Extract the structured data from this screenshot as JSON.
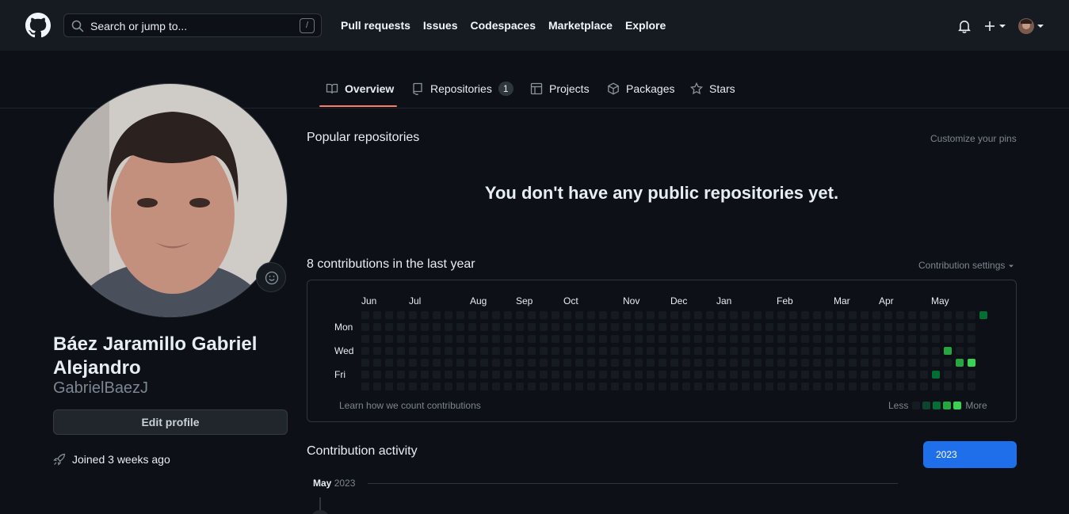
{
  "header": {
    "search_placeholder": "Search or jump to...",
    "search_shortcut": "/",
    "nav": [
      "Pull requests",
      "Issues",
      "Codespaces",
      "Marketplace",
      "Explore"
    ]
  },
  "tabs": {
    "overview": "Overview",
    "repositories": "Repositories",
    "repositories_count": "1",
    "projects": "Projects",
    "packages": "Packages",
    "stars": "Stars"
  },
  "profile": {
    "full_name": "Báez Jaramillo Gabriel Alejandro",
    "login": "GabrielBaezJ",
    "edit_label": "Edit profile",
    "joined": "Joined 3 weeks ago"
  },
  "popular": {
    "title": "Popular repositories",
    "customize": "Customize your pins",
    "empty": "You don't have any public repositories yet."
  },
  "contributions": {
    "title": "8 contributions in the last year",
    "settings": "Contribution settings",
    "months": [
      "Jun",
      "Jul",
      "Aug",
      "Sep",
      "Oct",
      "Nov",
      "Dec",
      "Jan",
      "Feb",
      "Mar",
      "Apr",
      "May"
    ],
    "day_labels": [
      "Mon",
      "Wed",
      "Fri"
    ],
    "learn": "Learn how we count contributions",
    "less": "Less",
    "more": "More",
    "weeks": 53,
    "active_cells": [
      {
        "week": 48,
        "day": 5,
        "level": 2
      },
      {
        "week": 49,
        "day": 3,
        "level": 3
      },
      {
        "week": 50,
        "day": 4,
        "level": 3
      },
      {
        "week": 51,
        "day": 4,
        "level": 4
      },
      {
        "week": 52,
        "day": 0,
        "level": 2
      }
    ],
    "colors": {
      "empty": "#161b22",
      "l1": "#0e4429",
      "l2": "#006d32",
      "l3": "#26a641",
      "l4": "#39d353"
    }
  },
  "activity": {
    "title": "Contribution activity",
    "year": "2023",
    "month": "May",
    "month_year": "2023"
  }
}
